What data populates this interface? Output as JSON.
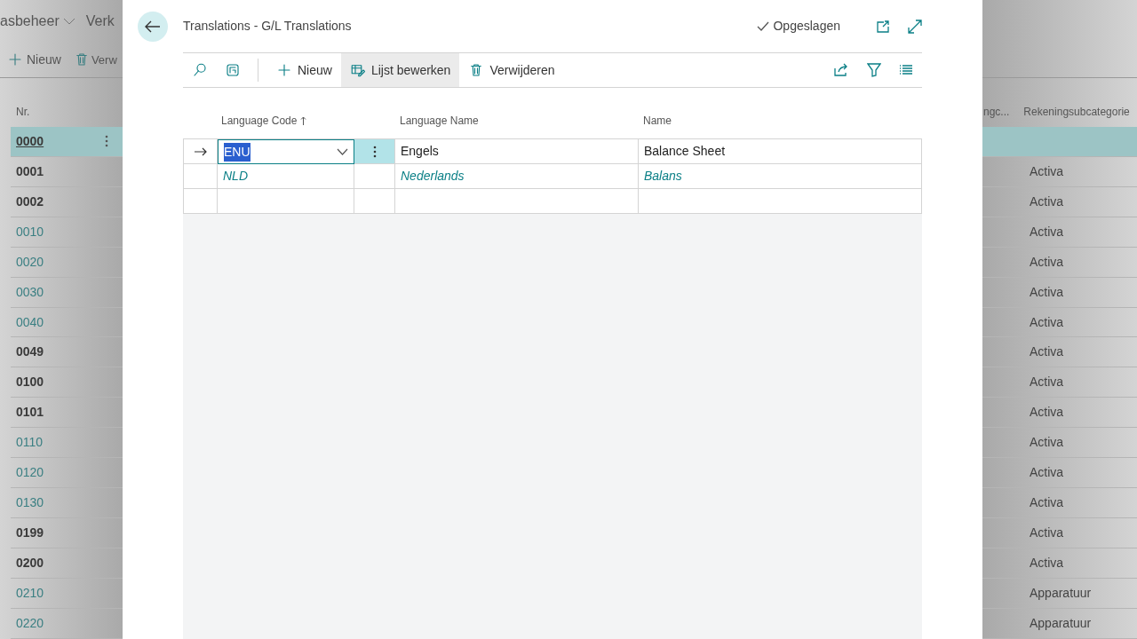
{
  "background": {
    "nav": [
      "asbeheer",
      "Verk"
    ],
    "actions": [
      "Nieuw",
      "Verw"
    ],
    "columns": {
      "number": "Nr.",
      "column_2": "ngc...",
      "subcategory": "Rekeningsubcategorie"
    },
    "rows": [
      {
        "nr": "0000",
        "bold": true,
        "selected": true,
        "subcategory": ""
      },
      {
        "nr": "0001",
        "bold": true,
        "selected": false,
        "subcategory": "Activa"
      },
      {
        "nr": "0002",
        "bold": true,
        "selected": false,
        "subcategory": "Activa"
      },
      {
        "nr": "0010",
        "bold": false,
        "selected": false,
        "subcategory": "Activa"
      },
      {
        "nr": "0020",
        "bold": false,
        "selected": false,
        "subcategory": "Activa"
      },
      {
        "nr": "0030",
        "bold": false,
        "selected": false,
        "subcategory": "Activa"
      },
      {
        "nr": "0040",
        "bold": false,
        "selected": false,
        "subcategory": "Activa"
      },
      {
        "nr": "0049",
        "bold": true,
        "selected": false,
        "subcategory": "Activa"
      },
      {
        "nr": "0100",
        "bold": true,
        "selected": false,
        "subcategory": "Activa"
      },
      {
        "nr": "0101",
        "bold": true,
        "selected": false,
        "subcategory": "Activa"
      },
      {
        "nr": "0110",
        "bold": false,
        "selected": false,
        "subcategory": "Activa"
      },
      {
        "nr": "0120",
        "bold": false,
        "selected": false,
        "subcategory": "Activa"
      },
      {
        "nr": "0130",
        "bold": false,
        "selected": false,
        "subcategory": "Activa"
      },
      {
        "nr": "0199",
        "bold": true,
        "selected": false,
        "subcategory": "Activa"
      },
      {
        "nr": "0200",
        "bold": true,
        "selected": false,
        "subcategory": "Activa"
      },
      {
        "nr": "0210",
        "bold": false,
        "selected": false,
        "subcategory": "Apparatuur"
      },
      {
        "nr": "0220",
        "bold": false,
        "selected": false,
        "subcategory": "Apparatuur"
      }
    ]
  },
  "dialog": {
    "title": "Translations - G/L Translations",
    "status": "Opgeslagen",
    "toolbar": [
      {
        "kind": "search"
      },
      {
        "kind": "layout"
      },
      {
        "kind": "new",
        "label": "Nieuw",
        "selected": false
      },
      {
        "kind": "edit",
        "label": "Lijst bewerken",
        "selected": true
      },
      {
        "kind": "delete",
        "label": "Verwijderen",
        "selected": false
      }
    ],
    "table": {
      "columns": [
        "Language Code",
        "Language Name",
        "Name"
      ],
      "rows": [
        {
          "selected": true,
          "code": "ENU",
          "language_name": "Engels",
          "name": "Balance Sheet",
          "italic": false
        },
        {
          "selected": false,
          "code": "NLD",
          "language_name": "Nederlands",
          "name": "Balans",
          "italic": true
        }
      ]
    }
  }
}
